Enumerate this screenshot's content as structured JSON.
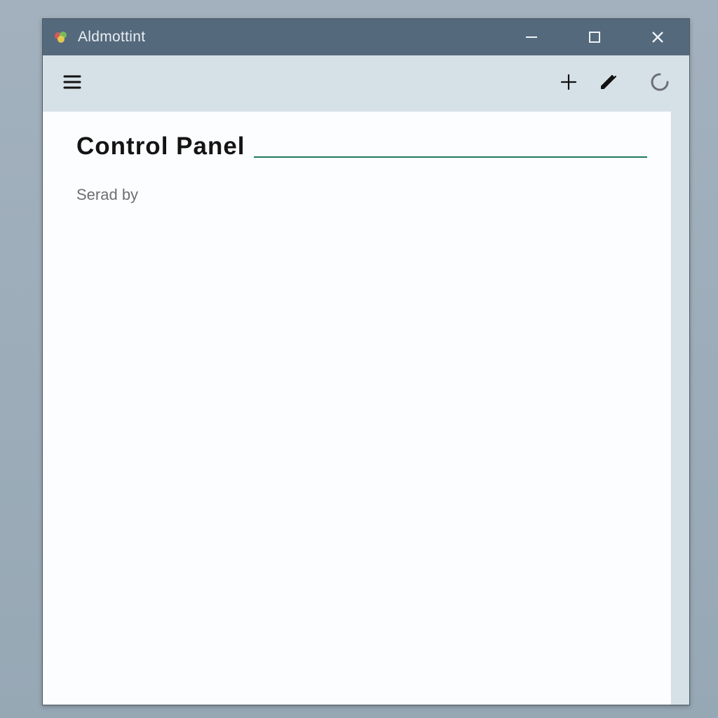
{
  "window": {
    "title": "Aldmottint"
  },
  "toolbar": {
    "icons": {
      "menu": "menu-icon",
      "add": "plus-icon",
      "edit": "pencil-icon",
      "refresh": "loading-icon"
    }
  },
  "main": {
    "heading": "Control Panel",
    "subtext": "Serad by"
  },
  "colors": {
    "titlebar": "#55697c",
    "accent_underline": "#1f7a5c",
    "panel_bg": "#d6e0e7",
    "page_bg": "#fcfdfe"
  }
}
